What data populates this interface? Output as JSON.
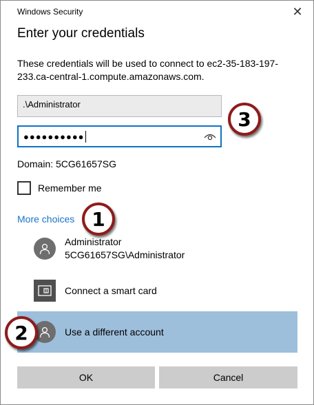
{
  "window": {
    "title": "Windows Security",
    "close_icon": "close-icon"
  },
  "dialog": {
    "heading": "Enter your credentials",
    "description": "These credentials will be used to connect to ec2-35-183-197-233.ca-central-1.compute.amazonaws.com.",
    "username_value": ".\\Administrator",
    "password_masked": "●●●●●●●●●●",
    "domain_text": "Domain: 5CG61657SG",
    "remember_label": "Remember me",
    "remember_checked": false,
    "more_choices_label": "More choices"
  },
  "options": [
    {
      "icon": "user-avatar-icon",
      "line1": "Administrator",
      "line2": "5CG61657SG\\Administrator"
    },
    {
      "icon": "smart-card-icon",
      "label": "Connect a smart card"
    },
    {
      "icon": "user-avatar-icon",
      "label": "Use a different account",
      "selected": true
    }
  ],
  "buttons": {
    "ok": "OK",
    "cancel": "Cancel"
  },
  "annotations": {
    "badge1": "1",
    "badge2": "2",
    "badge3": "3"
  },
  "colors": {
    "accent": "#0f72c6",
    "link": "#1a73c8",
    "selected_row": "#9dbfdc",
    "badge_border": "#8e1b1b"
  }
}
